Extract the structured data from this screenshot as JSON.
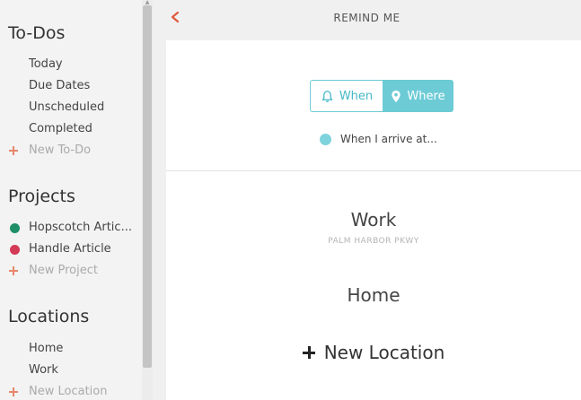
{
  "sidebar": {
    "todos": {
      "title": "To-Dos",
      "items": [
        "Today",
        "Due Dates",
        "Unscheduled",
        "Completed"
      ],
      "add_label": "New To-Do"
    },
    "projects": {
      "title": "Projects",
      "items": [
        {
          "label": "Hopscotch Artic...",
          "color": "#1f8f68"
        },
        {
          "label": "Handle Article",
          "color": "#d23a55"
        }
      ],
      "add_label": "New Project"
    },
    "locations": {
      "title": "Locations",
      "items": [
        "Home",
        "Work"
      ],
      "add_label": "New Location"
    }
  },
  "header": {
    "title": "REMIND ME"
  },
  "remind": {
    "when_label": "When",
    "where_label": "Where",
    "selected": "Where",
    "trigger_label": "When I arrive at..."
  },
  "locations_list": [
    {
      "name": "Work",
      "address": "PALM HARBOR PKWY"
    },
    {
      "name": "Home",
      "address": ""
    }
  ],
  "new_location_label": "New Location",
  "colors": {
    "accent": "#6dcbd6",
    "plus": "#e8866b",
    "back": "#e05a3a"
  }
}
